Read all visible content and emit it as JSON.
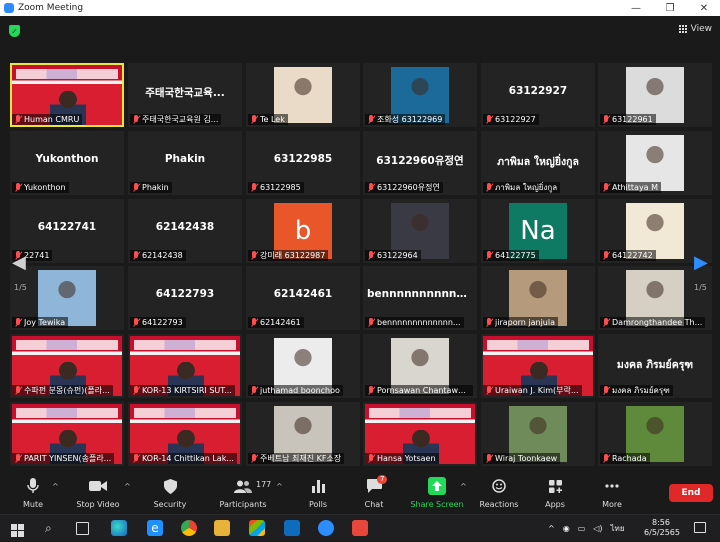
{
  "window": {
    "title": "Zoom Meeting",
    "minimize": "—",
    "maximize": "❐",
    "close": "✕"
  },
  "topbar": {
    "view_label": "View"
  },
  "pagination": {
    "left": "1/5",
    "right": "1/5"
  },
  "tiles": [
    {
      "label": "Human CMRU",
      "kind": "red",
      "active": true
    },
    {
      "label": "주태국한국교육원 김...",
      "center": "주태국한국교육..."
    },
    {
      "label": "Te Lek",
      "kind": "photo",
      "color": "#e9dbc7"
    },
    {
      "label": "조화성 63122969",
      "kind": "photo",
      "color": "#1b6a9a"
    },
    {
      "label": "63122927",
      "center": "63122927"
    },
    {
      "label": "63122961",
      "kind": "photo",
      "color": "#dcdcdc"
    },
    {
      "label": "Yukonthon",
      "center": "Yukonthon"
    },
    {
      "label": "Phakin",
      "center": "Phakin"
    },
    {
      "label": "63122985",
      "center": "63122985"
    },
    {
      "label": "63122960유정연",
      "center": "63122960유정연"
    },
    {
      "label": "ภาพิมล ใหญ่ยิ่งกูล",
      "center": "ภาพิมล ใหญ่ยิ่งกูล"
    },
    {
      "label": "Athittaya M",
      "kind": "photo",
      "color": "#e6e6e6"
    },
    {
      "label": "22741",
      "center": "64122741"
    },
    {
      "label": "62142438",
      "center": "62142438"
    },
    {
      "label": "강미래 63122987",
      "kind": "letter",
      "letter": "b",
      "color": "#e8562a"
    },
    {
      "label": "63122964",
      "kind": "photo",
      "color": "#3a3a44"
    },
    {
      "label": "64122775",
      "kind": "letter",
      "letter": "Na",
      "color": "#0f7a63"
    },
    {
      "label": "64122742",
      "kind": "photo",
      "color": "#f1e8d6"
    },
    {
      "label": "Joy Tewika",
      "kind": "photo",
      "color": "#8fb6d8"
    },
    {
      "label": "64122793",
      "center": "64122793"
    },
    {
      "label": "62142461",
      "center": "62142461"
    },
    {
      "label": "bennnnnnnnnnnnn...",
      "center": "bennnnnnnnnnnn..."
    },
    {
      "label": "jiraporn janjula",
      "kind": "photo",
      "color": "#b59b7c"
    },
    {
      "label": "Damrongthandee Th...",
      "kind": "photo",
      "color": "#d6d0c4"
    },
    {
      "label": "수파펀 분몽(슈펀)(폴라...",
      "kind": "red"
    },
    {
      "label": "KOR-13 KIRTSIRI SUT...",
      "kind": "red"
    },
    {
      "label": "juthamad boonchoo",
      "kind": "photo",
      "color": "#ececec"
    },
    {
      "label": "Pornsawan Chantawo...",
      "kind": "photo",
      "color": "#d9d5cf"
    },
    {
      "label": "Uraiwan J. Kim(부락...",
      "kind": "red"
    },
    {
      "label": "มงคล ภิรมย์ครุฑ",
      "center": "มงคล ภิรมย์ครุฑ"
    },
    {
      "label": "PARIT YINSEN(송플라...",
      "kind": "red"
    },
    {
      "label": "KOR-14 Chittikan Lak...",
      "kind": "red"
    },
    {
      "label": "주베트남 최재진 KF소장",
      "kind": "photo",
      "color": "#c8c4bc"
    },
    {
      "label": "Hansa Yotsaen",
      "kind": "red"
    },
    {
      "label": "Wiraj Toonkaew",
      "kind": "photo",
      "color": "#6f8b5a"
    },
    {
      "label": "Rachada",
      "kind": "photo",
      "color": "#5f8a3b"
    }
  ],
  "toolbar": {
    "mute": "Mute",
    "stop_video": "Stop Video",
    "security": "Security",
    "participants": "Participants",
    "participants_count": "177",
    "polls": "Polls",
    "chat": "Chat",
    "chat_badge": "7",
    "share_screen": "Share Screen",
    "reactions": "Reactions",
    "apps": "Apps",
    "more": "More",
    "end": "End"
  },
  "taskbar": {
    "lang": "ไทย",
    "time": "8:56",
    "date": "6/5/2565"
  },
  "colors": {
    "accent_green": "#23d959",
    "end_red": "#e02828",
    "active_outline": "#e8e83a"
  }
}
